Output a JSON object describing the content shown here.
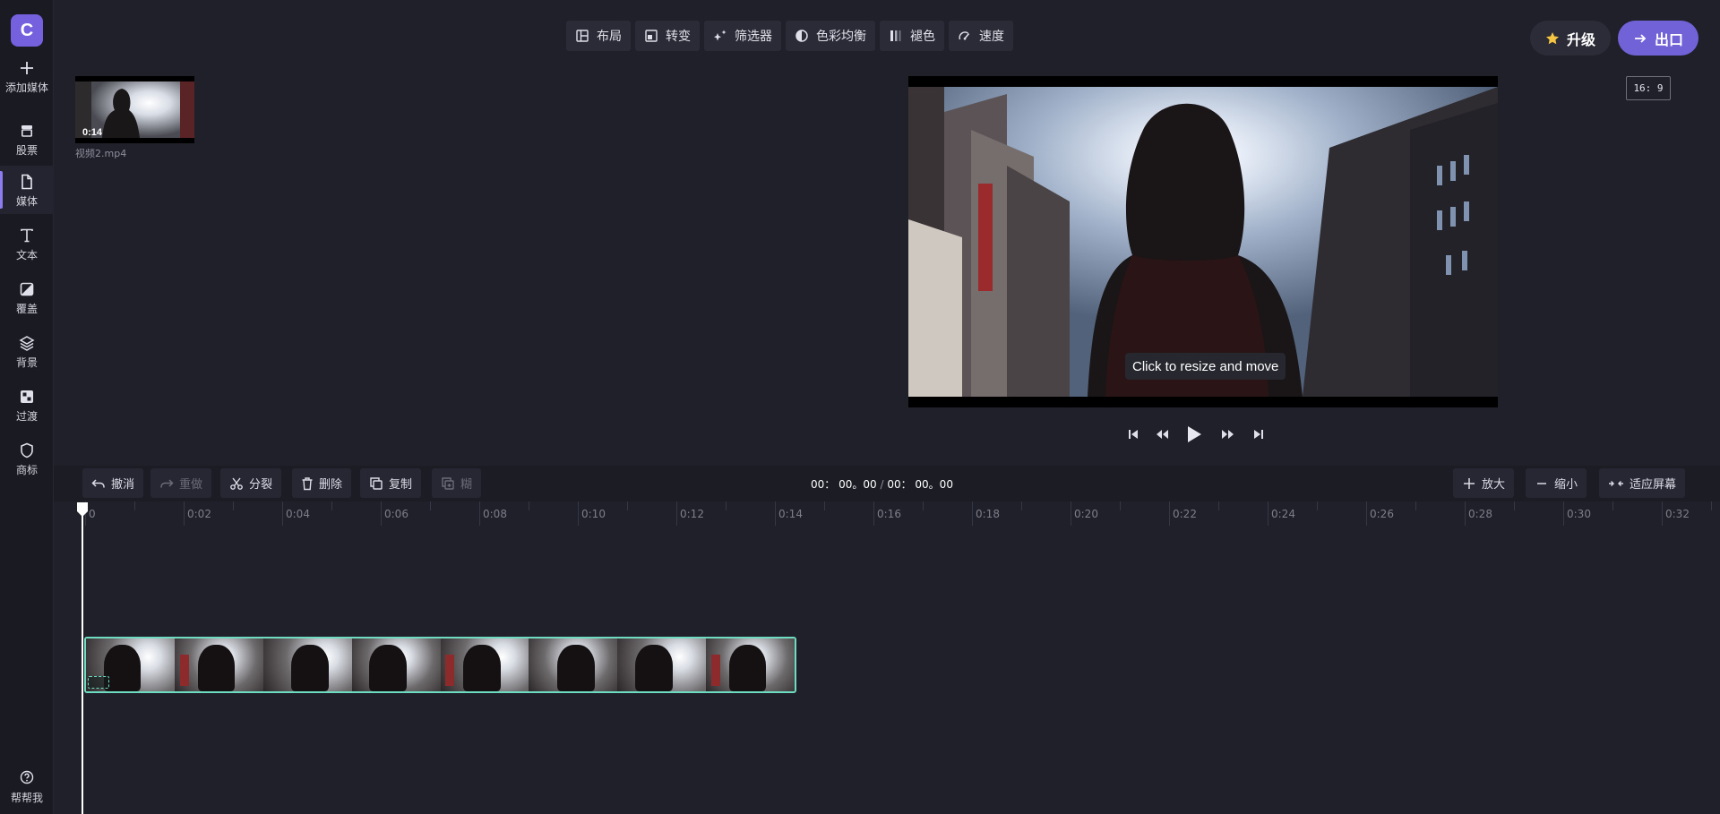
{
  "app": {
    "logo_letter": "C"
  },
  "sidebar": {
    "items": [
      {
        "label": "添加媒体",
        "icon": "plus-icon"
      },
      {
        "label": "股票",
        "icon": "stock-icon"
      },
      {
        "label": "媒体",
        "icon": "file-icon",
        "active": true
      },
      {
        "label": "文本",
        "icon": "text-icon"
      },
      {
        "label": "覆盖",
        "icon": "overlay-icon"
      },
      {
        "label": "背景",
        "icon": "layers-icon"
      },
      {
        "label": "过渡",
        "icon": "transition-icon"
      },
      {
        "label": "商标",
        "icon": "shield-icon"
      }
    ],
    "help_label": "帮帮我"
  },
  "toolbar": {
    "items": [
      {
        "label": "布局",
        "icon": "layout-icon"
      },
      {
        "label": "转变",
        "icon": "transform-icon"
      },
      {
        "label": "筛选器",
        "icon": "sparkle-icon"
      },
      {
        "label": "色彩均衡",
        "icon": "color-balance-icon"
      },
      {
        "label": "褪色",
        "icon": "fade-icon"
      },
      {
        "label": "速度",
        "icon": "speed-icon"
      }
    ]
  },
  "header": {
    "upgrade_label": "升级",
    "export_label": "出口",
    "aspect_ratio": "16: 9"
  },
  "media": {
    "items": [
      {
        "filename": "视频2.mp4",
        "duration": "0:14"
      }
    ]
  },
  "preview": {
    "tooltip": "Click to resize and move"
  },
  "player": {
    "controls": [
      "skip-start-icon",
      "rewind-icon",
      "play-icon",
      "fast-forward-icon",
      "skip-end-icon"
    ]
  },
  "timeline": {
    "undo_label": "撤消",
    "redo_label": "重做",
    "split_label": "分裂",
    "delete_label": "删除",
    "copy_label": "复制",
    "paste_label": "糊",
    "zoom_in_label": "放大",
    "zoom_out_label": "缩小",
    "fit_label": "适应屏幕",
    "time_current": "00： 00。00",
    "time_separator": "/",
    "time_total": "00： 00。00",
    "ruler_labels": [
      "0",
      "0:02",
      "0:04",
      "0:06",
      "0:08",
      "0:10",
      "0:12",
      "0:14",
      "0:16",
      "0:18",
      "0:20",
      "0:22",
      "0:24",
      "0:26",
      "0:28",
      "0:30",
      "0:32"
    ]
  },
  "colors": {
    "accent": "#7162d7",
    "clip_border": "#6ddcc1",
    "background": "#1f202a",
    "sidebar": "#191a22"
  }
}
